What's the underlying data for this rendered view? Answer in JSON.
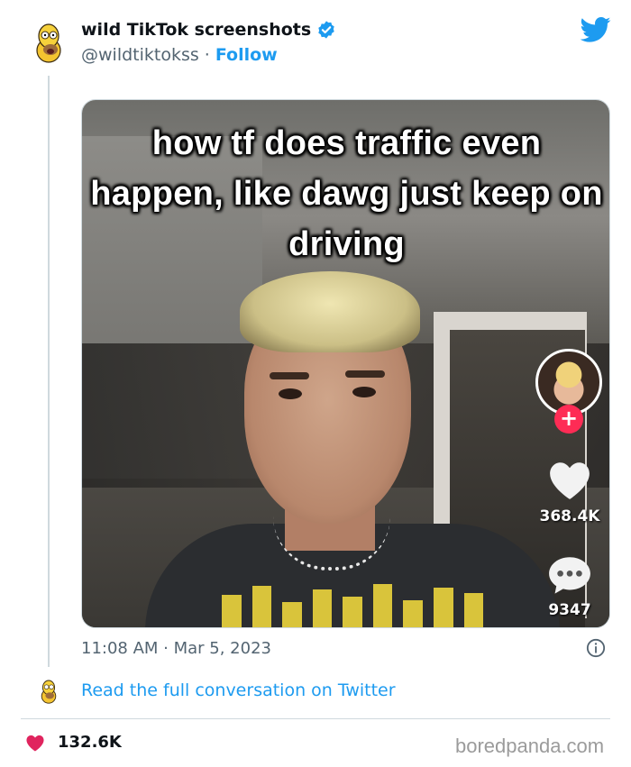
{
  "account": {
    "display_name": "wild TikTok screenshots",
    "handle": "@wildtiktokss",
    "separator": "·",
    "follow_label": "Follow",
    "verified": true,
    "avatar_icon": "cartoon-homer-avatar-icon"
  },
  "brand": {
    "logo_icon": "twitter-bird-icon",
    "color": "#1d9bf0"
  },
  "media": {
    "caption": "how tf does traffic even happen, like dawg just keep on driving",
    "likes": "368.4K",
    "comments": "9347",
    "follow_plus": "+",
    "plus_color": "#fe2c55"
  },
  "tweet": {
    "timestamp": "11:08 AM · Mar 5, 2023",
    "read_more": "Read the full conversation on Twitter"
  },
  "footer": {
    "likes": "132.6K",
    "heart_color": "#e0245e",
    "watermark": "boredpanda.com"
  }
}
